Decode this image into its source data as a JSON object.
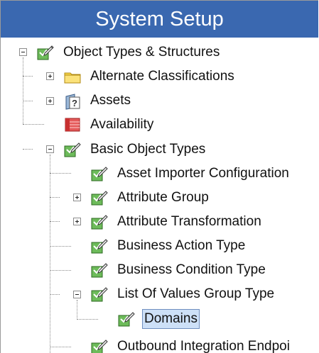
{
  "title": "System Setup",
  "tree": {
    "root": "Object Types & Structures",
    "alternate_classifications": "Alternate Classifications",
    "assets": "Assets",
    "availability": "Availability",
    "basic_object_types": "Basic Object Types",
    "asset_importer": "Asset Importer Configuration",
    "attribute_group": "Attribute Group",
    "attribute_transformation": "Attribute Transformation",
    "business_action_type": "Business Action Type",
    "business_condition_type": "Business Condition Type",
    "list_of_values_group_type": "List Of Values Group Type",
    "domains": "Domains",
    "outbound_integration": "Outbound Integration Endpoi"
  },
  "icons": {
    "object_type": "object-type-icon",
    "folder": "folder-icon",
    "assets": "assets-icon",
    "availability": "availability-icon"
  },
  "colors": {
    "title_bar": "#3a68b0",
    "selection": "#cde0f7",
    "folder": "#f7d64a",
    "object_type": "#6dbb5a"
  }
}
